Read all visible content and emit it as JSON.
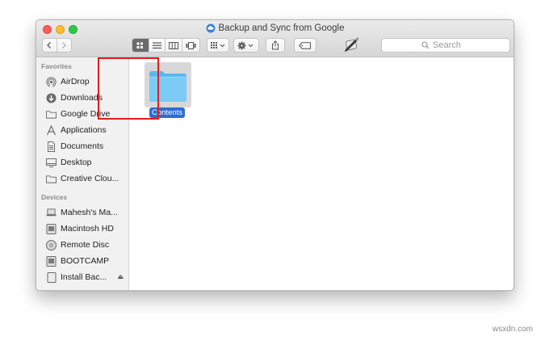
{
  "window": {
    "title": "Backup and Sync from Google"
  },
  "toolbar": {
    "search_placeholder": "Search"
  },
  "sidebar": {
    "favorites_header": "Favorites",
    "favorites": [
      {
        "label": "AirDrop",
        "icon": "airdrop-icon"
      },
      {
        "label": "Downloads",
        "icon": "downloads-icon"
      },
      {
        "label": "Google Drive",
        "icon": "folder-icon"
      },
      {
        "label": "Applications",
        "icon": "applications-icon"
      },
      {
        "label": "Documents",
        "icon": "documents-icon"
      },
      {
        "label": "Desktop",
        "icon": "desktop-icon"
      },
      {
        "label": "Creative Clou...",
        "icon": "folder-icon"
      }
    ],
    "devices_header": "Devices",
    "devices": [
      {
        "label": "Mahesh's Ma...",
        "icon": "laptop-icon"
      },
      {
        "label": "Macintosh HD",
        "icon": "hard-drive-icon"
      },
      {
        "label": "Remote Disc",
        "icon": "disc-icon"
      },
      {
        "label": "BOOTCAMP",
        "icon": "drive-icon"
      },
      {
        "label": "Install Bac...",
        "icon": "installer-disk-icon"
      }
    ]
  },
  "content": {
    "items": [
      {
        "label": "Contents",
        "icon": "folder-icon",
        "selected": true
      }
    ]
  },
  "watermark": "wsxdn.com",
  "colors": {
    "selection": "#2e6dd1",
    "highlight_box": "#e31d1d",
    "folder_blue": "#5ab8f0"
  }
}
